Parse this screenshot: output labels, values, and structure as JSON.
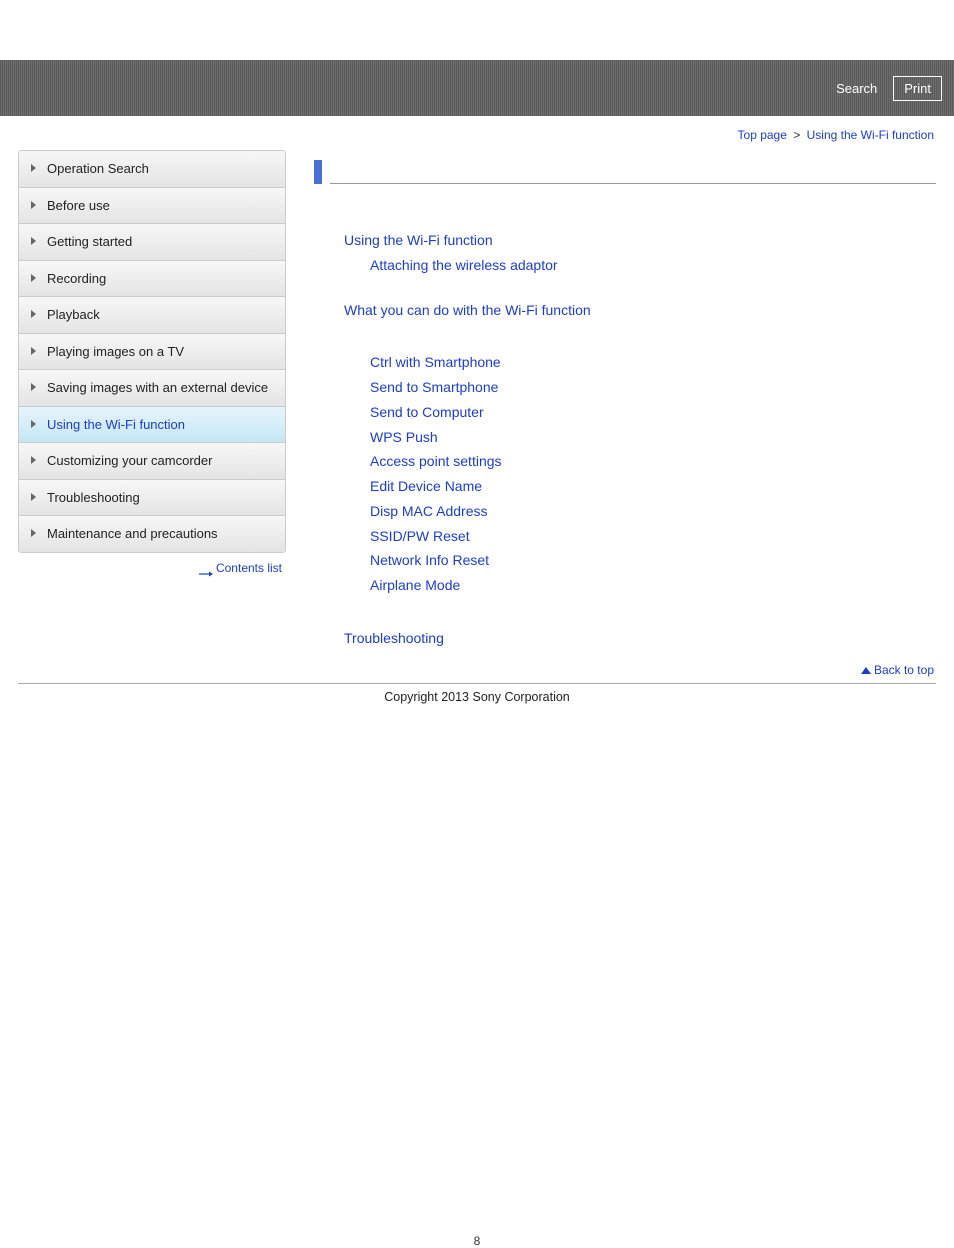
{
  "header": {
    "search": "Search",
    "print": "Print"
  },
  "breadcrumb": {
    "top": "Top page",
    "sep": ">",
    "current": "Using the Wi-Fi function"
  },
  "sidebar": {
    "items": [
      {
        "label": "Operation Search",
        "active": false
      },
      {
        "label": "Before use",
        "active": false
      },
      {
        "label": "Getting started",
        "active": false
      },
      {
        "label": "Recording",
        "active": false
      },
      {
        "label": "Playback",
        "active": false
      },
      {
        "label": "Playing images on a TV",
        "active": false
      },
      {
        "label": "Saving images with an external device",
        "active": false
      },
      {
        "label": "Using the Wi-Fi function",
        "active": true
      },
      {
        "label": "Customizing your camcorder",
        "active": false
      },
      {
        "label": "Troubleshooting",
        "active": false
      },
      {
        "label": "Maintenance and precautions",
        "active": false
      }
    ],
    "contents_list": "Contents list"
  },
  "main": {
    "section_title": "Using the Wi-Fi function",
    "links_g1": [
      "Attaching the wireless adaptor"
    ],
    "links_g2": [
      "What you can do with the Wi-Fi function"
    ],
    "links_g3": [
      "Ctrl with Smartphone",
      "Send to Smartphone",
      "Send to Computer",
      "WPS Push",
      "Access point settings",
      "Edit Device Name",
      "Disp MAC Address",
      "SSID/PW Reset",
      "Network Info Reset",
      "Airplane Mode"
    ],
    "links_g4": [
      "Troubleshooting"
    ]
  },
  "back_to_top": "Back to top",
  "copyright": "Copyright 2013 Sony Corporation",
  "page_number": "8"
}
